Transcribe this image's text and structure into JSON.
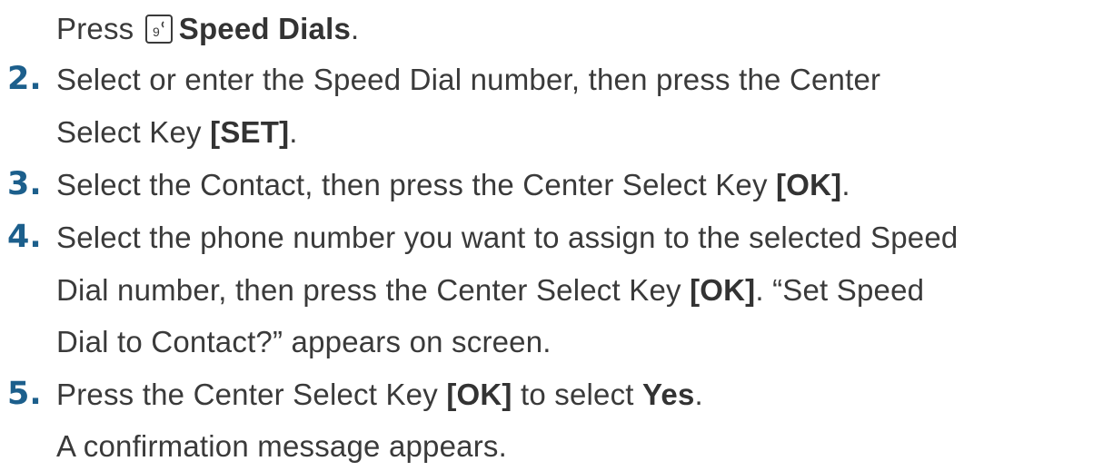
{
  "intro": {
    "prefix": "Press",
    "key_icon": "nine-key-icon",
    "bold": "Speed Dials",
    "suffix": "."
  },
  "steps": [
    {
      "number": "2.",
      "lines": [
        "Select or enter the Speed Dial number, then press the Center",
        {
          "text": "Select Key ",
          "bold": "[SET]",
          "after": "."
        }
      ]
    },
    {
      "number": "3.",
      "lines": [
        {
          "text": "Select the Contact, then press the Center Select Key ",
          "bold": "[OK]",
          "after": "."
        }
      ]
    },
    {
      "number": "4.",
      "lines": [
        "Select the phone number you want to assign to the selected Speed",
        {
          "text": "Dial number, then press the Center Select Key ",
          "bold": "[OK]",
          "after": ". “Set Speed"
        },
        "Dial to Contact?” appears on screen."
      ]
    },
    {
      "number": "5.",
      "lines": [
        {
          "text": "Press the Center Select Key ",
          "bold": "[OK]",
          "middle": " to select ",
          "bold2": "Yes",
          "after": "."
        },
        "A confirmation message appears."
      ]
    }
  ],
  "colors": {
    "step_number": "#1c5f8c",
    "text": "#3a3a3a"
  }
}
